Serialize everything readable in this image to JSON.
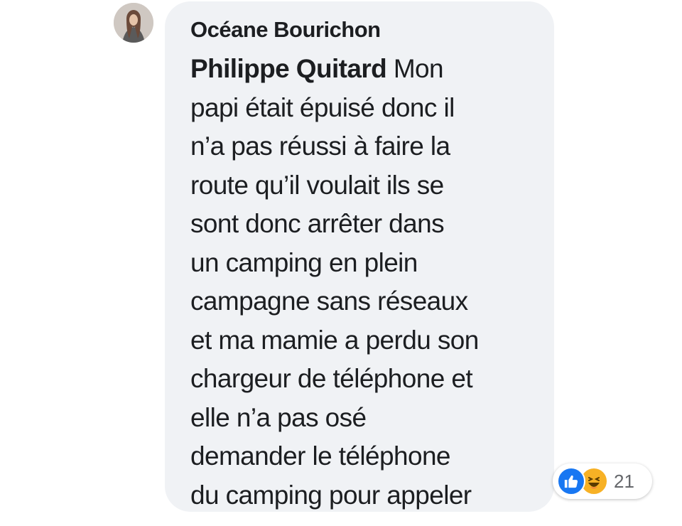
{
  "comment": {
    "author": "Océane Bourichon",
    "mention": "Philippe Quitard",
    "text_lines": [
      " Mon",
      "papi était épuisé  donc il",
      "n’a pas réussi à faire la",
      "route qu’il voulait ils se",
      "sont donc arrêter dans",
      "un camping en plein",
      "campagne sans réseaux",
      "et ma mamie a perdu son",
      "chargeur de téléphone et",
      "elle n’a pas osé",
      "demander le téléphone",
      "du camping pour appeler"
    ]
  },
  "reactions": {
    "icons": [
      "like-icon",
      "haha-icon"
    ],
    "count": "21"
  },
  "colors": {
    "bubble": "#f0f2f5",
    "like": "#1877f2",
    "haha": "#f7b125",
    "text": "#1c1e21",
    "secondary": "#65676b"
  }
}
